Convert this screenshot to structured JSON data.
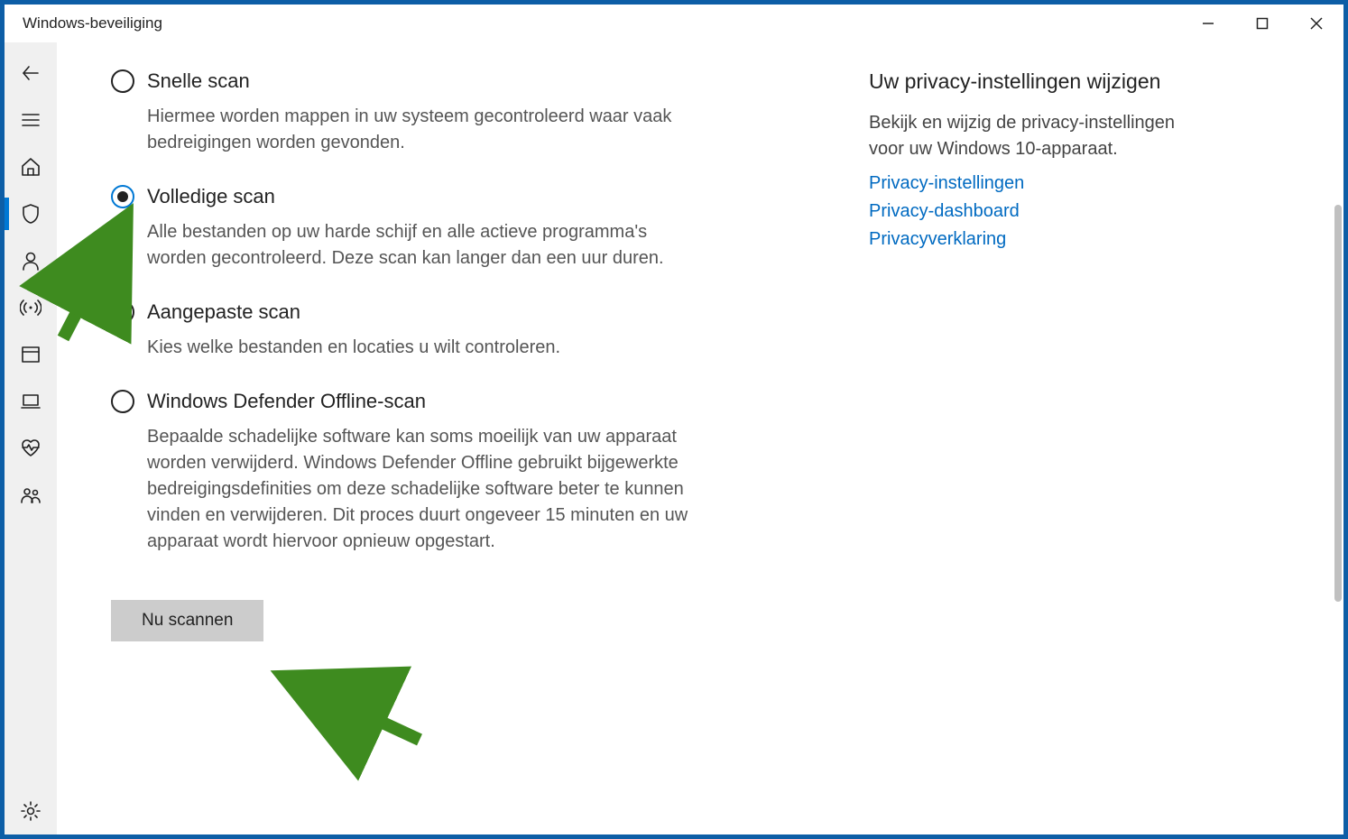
{
  "window": {
    "title": "Windows-beveiliging"
  },
  "scanOptions": [
    {
      "id": "quick",
      "label": "Snelle scan",
      "selected": false,
      "desc": "Hiermee worden mappen in uw systeem gecontroleerd waar vaak bedreigingen worden gevonden."
    },
    {
      "id": "full",
      "label": "Volledige scan",
      "selected": true,
      "desc": "Alle bestanden op uw harde schijf en alle actieve programma's worden gecontroleerd. Deze scan kan langer dan een uur duren."
    },
    {
      "id": "custom",
      "label": "Aangepaste scan",
      "selected": false,
      "desc": "Kies welke bestanden en locaties u wilt controleren."
    },
    {
      "id": "offline",
      "label": "Windows Defender Offline-scan",
      "selected": false,
      "desc": "Bepaalde schadelijke software kan soms moeilijk van uw apparaat worden verwijderd. Windows Defender Offline gebruikt bijgewerkte bedreigingsdefinities om deze schadelijke software beter te kunnen vinden en verwijderen. Dit proces duurt ongeveer 15 minuten en uw apparaat wordt hiervoor opnieuw opgestart."
    }
  ],
  "scanButton": "Nu scannen",
  "rightPanel": {
    "title": "Uw privacy-instellingen wijzigen",
    "desc": "Bekijk en wijzig de privacy-instellingen voor uw Windows 10-apparaat.",
    "links": [
      "Privacy-instellingen",
      "Privacy-dashboard",
      "Privacyverklaring"
    ]
  }
}
